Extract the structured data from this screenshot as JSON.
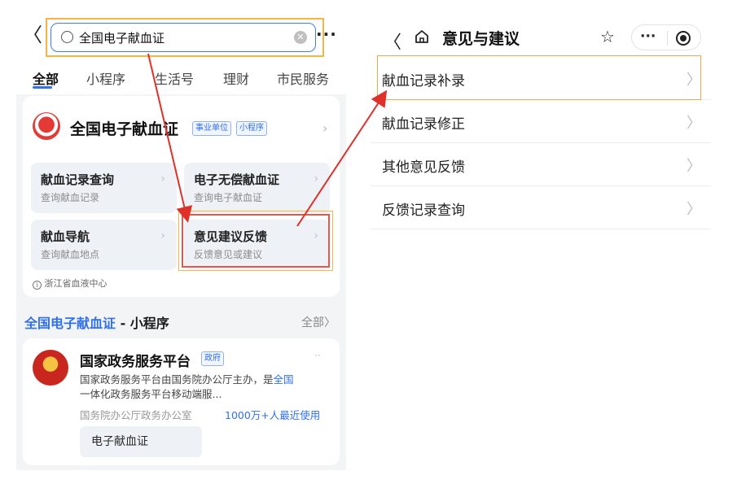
{
  "left": {
    "search": {
      "query": "全国电子献血证",
      "clear_icon": "clear-icon",
      "search_icon": "search-icon"
    },
    "more_label": "···",
    "back_label": "〈",
    "tabs": [
      "全部",
      "小程序",
      "生活号",
      "理财",
      "市民服务"
    ],
    "card": {
      "title": "全国电子献血证",
      "tags": [
        "事业单位",
        "小程序"
      ],
      "chevron": "›",
      "tiles": [
        {
          "title": "献血记录查询",
          "sub": "查询献血记录"
        },
        {
          "title": "电子无偿献血证",
          "sub": "查询电子献血证"
        },
        {
          "title": "献血导航",
          "sub": "查询献血地点"
        },
        {
          "title": "意见建议反馈",
          "sub": "反馈意见或建议"
        }
      ],
      "provider": "浙江省血液中心"
    },
    "section": {
      "title_highlight": "全国电子献血证",
      "title_rest": " - 小程序",
      "all_label": "全部〉"
    },
    "card2": {
      "title": "国家政务服务平台",
      "tag": "政府",
      "dots": "··",
      "desc_before": "国家政务服务平台由国务院办公厅主办，是",
      "desc_highlight": "全国",
      "desc_after": "一体化政务服务平台移动端服...",
      "meta": "国务院办公厅政务办公室",
      "usage": "1000万+人最近使用",
      "chip": "电子献血证"
    }
  },
  "right": {
    "back_label": "〈",
    "title": "意见与建议",
    "star_label": "☆",
    "capsule_dots": "···",
    "rows": [
      "献血记录补录",
      "献血记录修正",
      "其他意见反馈",
      "反馈记录查询"
    ],
    "chevron": "〉"
  },
  "colors": {
    "accent": "#2f6ff2",
    "highlight_orange": "#f1b64a",
    "arrow_red": "#e0302a"
  }
}
